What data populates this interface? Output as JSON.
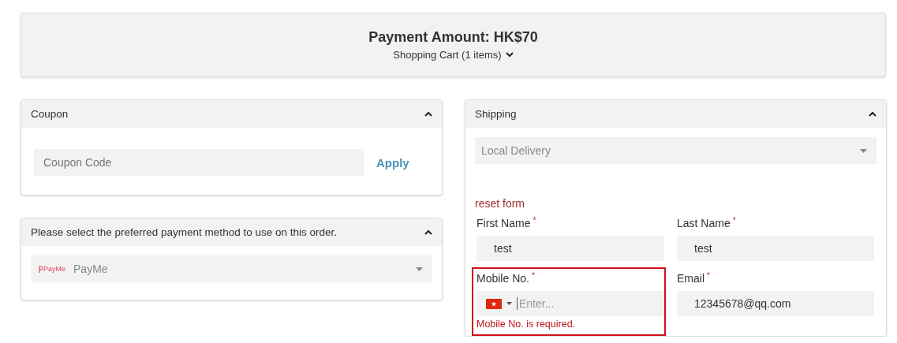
{
  "summary": {
    "title": "Payment Amount: HK$70",
    "cart_label": "Shopping Cart (1 items)",
    "cart_expanded": false
  },
  "coupon": {
    "title": "Coupon",
    "expanded": true,
    "placeholder": "Coupon Code",
    "button": "Apply"
  },
  "payment": {
    "title": "Please select the preferred payment method to use on this order.",
    "expanded": true,
    "logo_text": "PayMe",
    "value": "PayMe"
  },
  "shipping": {
    "title": "Shipping",
    "expanded": true,
    "method": "Local Delivery",
    "reset_link": "reset form",
    "fields": [
      {
        "kind": "text",
        "label": "First Name",
        "mark": "*",
        "value": "test",
        "invalid": false
      },
      {
        "kind": "text",
        "label": "Last Name",
        "mark": "*",
        "value": "test",
        "invalid": false
      },
      {
        "kind": "phone",
        "label": "Mobile No.",
        "mark": "*",
        "placeholder": "Enter...",
        "invalid": true,
        "error": "Mobile No. is required."
      },
      {
        "kind": "text",
        "label": "Email",
        "mark": "*",
        "value": "12345678@qq.com",
        "invalid": false
      }
    ]
  }
}
